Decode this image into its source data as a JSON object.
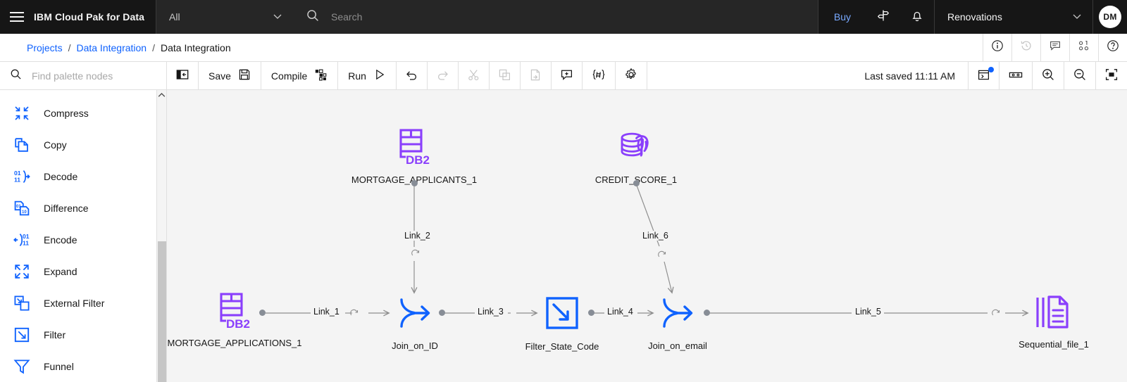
{
  "header": {
    "menu_icon": "hamburger-menu-icon",
    "title": "IBM Cloud Pak for Data",
    "scope_value": "All",
    "scope_chevron": "chevron-down-icon",
    "search_icon": "search-icon",
    "search_placeholder": "Search",
    "search_value": "",
    "buy_label": "Buy",
    "signpost_icon": "signpost-icon",
    "notification_icon": "bell-icon",
    "account_name": "Renovations",
    "account_chevron": "chevron-down-icon",
    "avatar_initials": "DM"
  },
  "breadcrumb": {
    "items": [
      {
        "label": "Projects",
        "type": "link"
      },
      {
        "label": "Data Integration",
        "type": "link"
      },
      {
        "label": "Data Integration",
        "type": "current"
      }
    ],
    "separator": "/",
    "actions": [
      {
        "name": "info-icon",
        "label": "Information"
      },
      {
        "name": "history-icon",
        "label": "History"
      },
      {
        "name": "comment-icon",
        "label": "Comments"
      },
      {
        "name": "connections-icon",
        "label": "Connections"
      },
      {
        "name": "help-icon",
        "label": "Help"
      }
    ]
  },
  "palette": {
    "search_icon": "search-icon",
    "search_placeholder": "Find palette nodes",
    "search_value": "",
    "scroll_up_icon": "chevron-up-icon",
    "items": [
      {
        "label": "Compress",
        "icon": "compress-icon"
      },
      {
        "label": "Copy",
        "icon": "copy-icon"
      },
      {
        "label": "Decode",
        "icon": "decode-icon"
      },
      {
        "label": "Difference",
        "icon": "difference-icon"
      },
      {
        "label": "Encode",
        "icon": "encode-icon"
      },
      {
        "label": "Expand",
        "icon": "expand-icon"
      },
      {
        "label": "External Filter",
        "icon": "external-filter-icon"
      },
      {
        "label": "Filter",
        "icon": "filter-icon"
      },
      {
        "label": "Funnel",
        "icon": "funnel-icon"
      }
    ]
  },
  "toolbar": {
    "panel_toggle_icon": "show-left-panel-icon",
    "save_label": "Save",
    "save_icon": "save-icon",
    "compile_label": "Compile",
    "compile_icon": "compile-icon",
    "run_label": "Run",
    "run_icon": "play-icon",
    "undo_icon": "undo-icon",
    "redo_icon": "redo-icon",
    "cut_icon": "cut-icon",
    "copy_icon": "copy-icon",
    "paste_icon": "paste-icon",
    "add_comment_icon": "add-comment-icon",
    "parameters_icon": "parameters-icon",
    "settings_icon": "gear-icon",
    "last_saved": "Last saved 11:11 AM",
    "notification_panel_icon": "open-panel-icon",
    "fit_width_icon": "fit-width-icon",
    "zoom_in_icon": "zoom-in-icon",
    "zoom_out_icon": "zoom-out-icon",
    "zoom_fit_icon": "zoom-to-fit-icon"
  },
  "canvas": {
    "nodes": [
      {
        "id": "n1",
        "label": "MORTGAGE_APPLICANTS_1",
        "icon": "db2-icon"
      },
      {
        "id": "n2",
        "label": "CREDIT_SCORE_1",
        "icon": "postgres-database-icon"
      },
      {
        "id": "n3",
        "label": "MORTGAGE_APPLICATIONS_1",
        "icon": "db2-icon"
      },
      {
        "id": "n4",
        "label": "Join_on_ID",
        "icon": "join-icon"
      },
      {
        "id": "n5",
        "label": "Filter_State_Code",
        "icon": "filter-node-icon"
      },
      {
        "id": "n6",
        "label": "Join_on_email",
        "icon": "join-icon"
      },
      {
        "id": "n7",
        "label": "Sequential_file_1",
        "icon": "sequential-file-icon"
      }
    ],
    "links": [
      {
        "id": "l1",
        "label": "Link_1",
        "from": "n3",
        "to": "n4"
      },
      {
        "id": "l2",
        "label": "Link_2",
        "from": "n1",
        "to": "n4"
      },
      {
        "id": "l3",
        "label": "Link_3",
        "from": "n4",
        "to": "n5"
      },
      {
        "id": "l4",
        "label": "Link_4",
        "from": "n5",
        "to": "n6"
      },
      {
        "id": "l5",
        "label": "Link_5",
        "from": "n6",
        "to": "n7"
      },
      {
        "id": "l6",
        "label": "Link_6",
        "from": "n2",
        "to": "n6"
      }
    ]
  }
}
